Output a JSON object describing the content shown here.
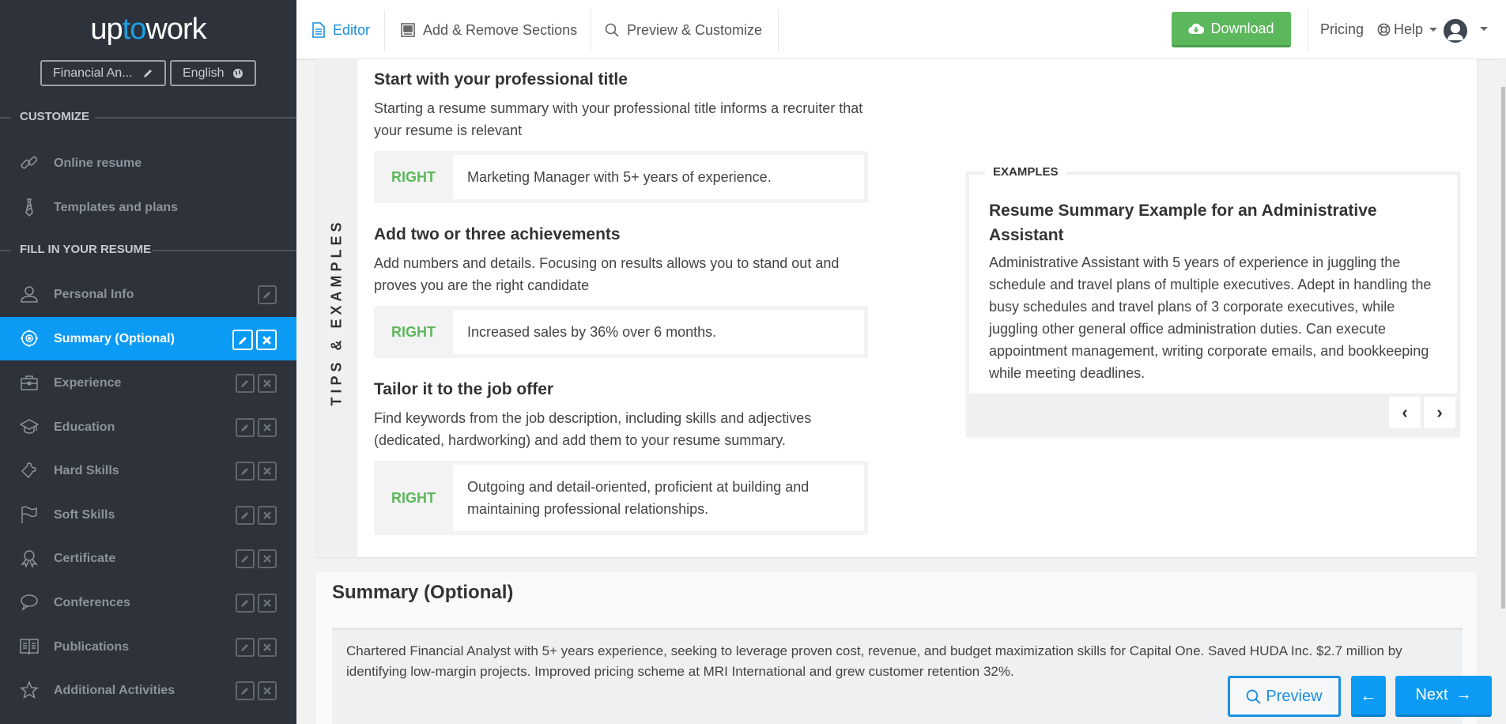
{
  "sidebar": {
    "logo": {
      "part1": "up",
      "part2": "to",
      "part3": "work"
    },
    "document_name": "Financial An...",
    "language": "English",
    "sections": {
      "customize": "CUSTOMIZE",
      "fill": "FILL IN YOUR RESUME"
    },
    "customize_items": [
      {
        "label": "Online resume",
        "icon": "link-icon"
      },
      {
        "label": "Templates and plans",
        "icon": "tie-icon"
      }
    ],
    "fill_items": [
      {
        "label": "Personal Info",
        "icon": "user-icon",
        "active": false,
        "removable": false
      },
      {
        "label": "Summary (Optional)",
        "icon": "target-icon",
        "active": true,
        "removable": true
      },
      {
        "label": "Experience",
        "icon": "briefcase-icon",
        "active": false,
        "removable": true
      },
      {
        "label": "Education",
        "icon": "graduation-cap-icon",
        "active": false,
        "removable": true
      },
      {
        "label": "Hard Skills",
        "icon": "puzzle-icon",
        "active": false,
        "removable": true
      },
      {
        "label": "Soft Skills",
        "icon": "flag-icon",
        "active": false,
        "removable": true
      },
      {
        "label": "Certificate",
        "icon": "award-icon",
        "active": false,
        "removable": true
      },
      {
        "label": "Conferences",
        "icon": "speech-bubble-icon",
        "active": false,
        "removable": true
      },
      {
        "label": "Publications",
        "icon": "book-icon",
        "active": false,
        "removable": true
      },
      {
        "label": "Additional Activities",
        "icon": "star-icon",
        "active": false,
        "removable": true
      }
    ]
  },
  "topbar": {
    "tabs": [
      {
        "label": "Editor",
        "icon": "document-icon",
        "active": true
      },
      {
        "label": "Add & Remove Sections",
        "icon": "layout-icon",
        "active": false
      },
      {
        "label": "Preview & Customize",
        "icon": "search-icon",
        "active": false
      }
    ],
    "download_label": "Download",
    "pricing_label": "Pricing",
    "help_label": "Help"
  },
  "tips": {
    "rail_label": "TIPS & EXAMPLES",
    "items": [
      {
        "title": "Start with your professional title",
        "text": "Starting a resume summary with your professional title informs a recruiter that your resume is relevant",
        "right_label": "RIGHT",
        "example": "Marketing Manager with 5+ years of experience."
      },
      {
        "title": "Add two or three achievements",
        "text": "Add numbers and details. Focusing on results allows you to stand out and proves you are the right candidate",
        "right_label": "RIGHT",
        "example": "Increased sales by 36% over 6 months."
      },
      {
        "title": "Tailor it to the job offer",
        "text": "Find keywords from the job description, including skills and adjectives (dedicated, hardworking) and add them to your resume summary.",
        "right_label": "RIGHT",
        "example": "Outgoing and detail-oriented, proficient at building and maintaining professional relationships."
      }
    ],
    "examples": {
      "legend": "EXAMPLES",
      "title": "Resume Summary Example for an Administrative Assistant",
      "body": "Administrative Assistant with 5 years of experience in juggling the schedule and travel plans of multiple executives. Adept in handling the busy schedules and travel plans of 3 corporate executives, while juggling other general office administration duties. Can execute appointment management, writing corporate emails, and bookkeeping while meeting deadlines.",
      "prev": "‹",
      "next": "›"
    }
  },
  "summary": {
    "title": "Summary (Optional)",
    "text": "Chartered Financial Analyst with 5+ years experience, seeking to leverage proven cost, revenue, and budget maximization skills for Capital One. Saved HUDA Inc. $2.7 million by identifying low-margin projects. Improved pricing scheme at MRI International and grew customer retention 32%."
  },
  "footer_buttons": {
    "preview": "Preview",
    "back": "←",
    "next": "Next",
    "next_arrow": "→"
  },
  "colors": {
    "sidebar_bg": "#2d323b",
    "accent_blue": "#0b9bf5",
    "download_green": "#5cb85c",
    "right_green": "#5cb85c"
  }
}
